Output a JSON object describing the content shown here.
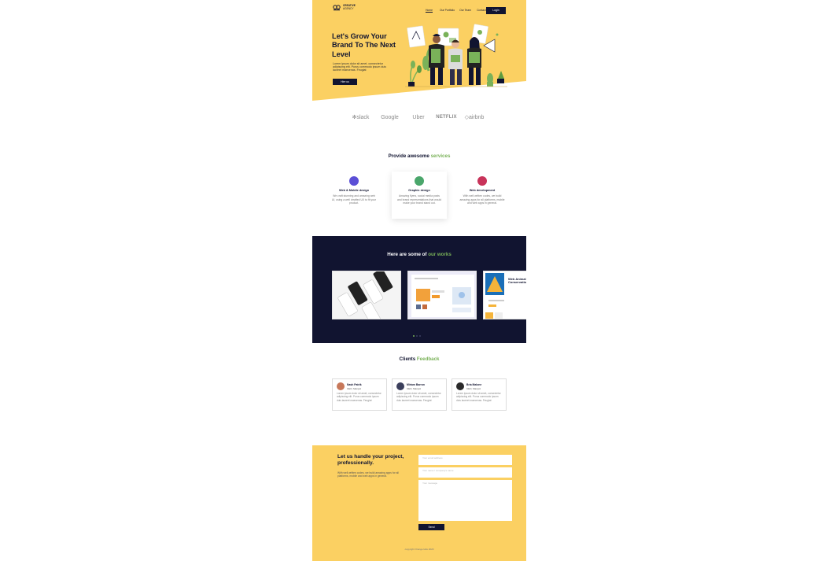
{
  "brand": {
    "name_line1": "CREATIVE",
    "name_line2": "AGENCY"
  },
  "nav": {
    "links": [
      "Home",
      "Our Portfolio",
      "Our Team",
      "Contact Us"
    ],
    "login_label": "Login"
  },
  "hero": {
    "title": "Let's Grow Your Brand To The Next Level",
    "text": "Lorem ipsum dolor sit amet, consectetur adipiscing elit. Purus commodo ipsum duis laoreet maecenas. Feugiat",
    "button_label": "Hire us"
  },
  "partners": [
    "slack",
    "Google",
    "Uber",
    "NETFLIX",
    "airbnb"
  ],
  "services": {
    "title_prefix": "Provide awesome",
    "title_accent": "services",
    "items": [
      {
        "title": "Web & Mobile design",
        "desc": "We craft stunning and amazing web UI, using a well drrafted UX to fit your product."
      },
      {
        "title": "Graphic design",
        "desc": "Amazing flyers, social media posts and brand representations that would make your brand stand out."
      },
      {
        "title": "Web development",
        "desc": "With well written codes, we build amazing apps for all platforms, mobile and web apps in general."
      }
    ]
  },
  "works": {
    "title_prefix": "Here are some of",
    "title_accent": "our works",
    "slide3_caption": "Web Animal Conservation"
  },
  "feedback": {
    "title_prefix": "Clients",
    "title_accent": "Feedback",
    "items": [
      {
        "name": "Nash Patrik",
        "role": "CEO, Manpol",
        "text": "Lorem ipsum dolor sit amet, consectetur adipiscing elit. Purus commodo ipsum duis laoreet maecenas. Feugiat"
      },
      {
        "name": "Miriam Barron",
        "role": "CEO, Manpol",
        "text": "Lorem ipsum dolor sit amet, consectetur adipiscing elit. Purus commodo ipsum duis laoreet maecenas. Feugiat"
      },
      {
        "name": "Bria Malone",
        "role": "CEO, Manpol",
        "text": "Lorem ipsum dolor sit amet, consectetur adipiscing elit. Purus commodo ipsum duis laoreet maecenas. Feugiat"
      }
    ]
  },
  "contact": {
    "title": "Let us handle your project, professionally.",
    "text": "With well written codes, we build amazing apps for all platforms, mobile and web apps in general.",
    "email_placeholder": "Your email address",
    "name_placeholder": "Your name / company's name",
    "message_placeholder": "Your message",
    "send_label": "Send",
    "copyright": "copyright Orange labs 2020"
  },
  "colors": {
    "yellow": "#fbd062",
    "navy": "#111430",
    "green": "#7ab259"
  }
}
